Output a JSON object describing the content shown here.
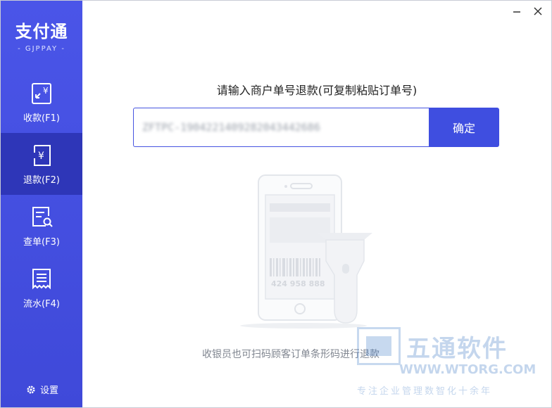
{
  "sidebar": {
    "logo_title": "支付通",
    "logo_subtitle": "- GJPPAY -",
    "items": [
      {
        "label": "收款(F1)",
        "icon": "receive-icon"
      },
      {
        "label": "退款(F2)",
        "icon": "refund-icon"
      },
      {
        "label": "查单(F3)",
        "icon": "query-icon"
      },
      {
        "label": "流水(F4)",
        "icon": "ledger-icon"
      }
    ],
    "settings_label": "设置",
    "active_item": "退款(F2)"
  },
  "window": {
    "minimize": "minimize-icon",
    "close": "close-icon"
  },
  "refund": {
    "prompt": "请输入商户单号退款(可复制粘贴订单号)",
    "input_value": "ZFTPC-1904221409282043442686",
    "confirm_label": "确定",
    "hint": "收银员也可扫码顾客订单条形码进行退款"
  },
  "illustration": {
    "barcode_number": "424 958 888"
  },
  "watermark": {
    "title": "五通软件",
    "url": "WWW.WTORG.COM",
    "subtitle": "专注企业管理数智化十余年"
  },
  "colors": {
    "accent": "#3f4ee0",
    "sidebar": "#4a55e8",
    "sidebar_active": "#2e36b8"
  }
}
